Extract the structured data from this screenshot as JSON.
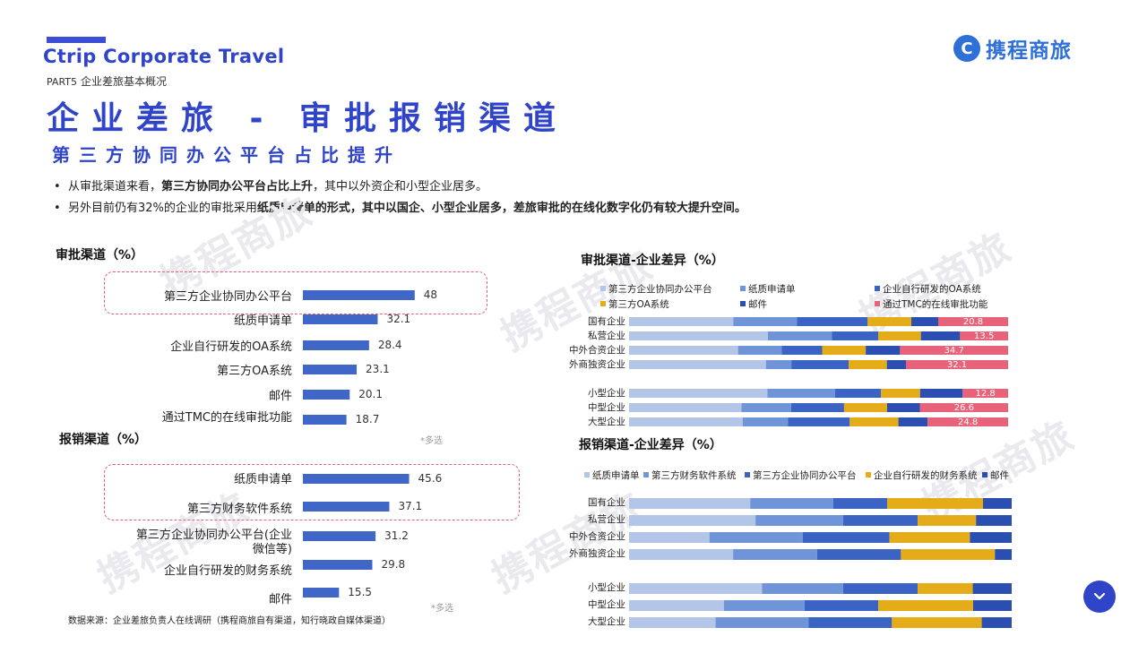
{
  "header": {
    "brand": "Ctrip Corporate Travel",
    "part_number": "PART5",
    "part_title": "企业差旅基本概况",
    "logo_text": "携程商旅",
    "title": "企业差旅 - 审批报销渠道",
    "subtitle": "第三方协同办公平台占比提升"
  },
  "bullets": [
    {
      "text_a": "从审批渠道来看，",
      "text_b": "第三方协同办公平台占比上升",
      "text_c": "，其中以外资企和小型企业居多。"
    },
    {
      "text_a": "另外目前仍有32%的企业的审批采用",
      "text_b": "纸质申请单的形式，其中以国企、小型企业居多，差旅审批的在线化数字化仍有较大提升空间。",
      "text_c": ""
    }
  ],
  "watermark": "携程商旅",
  "footer": {
    "note_approval": "*多选",
    "note_reimburse": "*多选",
    "source": "数据来源：企业差旅负责人在线调研（携程商旅自有渠道，知行晓政自媒体渠道）"
  },
  "colors": {
    "brand": "#2f44c8",
    "bar": "#4066c8",
    "s1": "#b4c6e7",
    "s2": "#6f94d8",
    "s3": "#3b63c4",
    "s4": "#e3ac18",
    "s5": "#2b4fb0",
    "s6": "#e8637a"
  },
  "chart_data": [
    {
      "id": "approval",
      "type": "bar",
      "title": "审批渠道（%）",
      "orientation": "horizontal",
      "categories": [
        "第三方企业协同办公平台",
        "纸质申请单",
        "企业自行研发的OA系统",
        "第三方OA系统",
        "邮件",
        "通过TMC的在线审批功能"
      ],
      "values": [
        48,
        32.1,
        28.4,
        23.1,
        20.1,
        18.7
      ],
      "value_labels": [
        "48",
        "32.1",
        "28.4",
        "23.1",
        "20.1",
        "18.7"
      ],
      "xlim": [
        0,
        60
      ]
    },
    {
      "id": "reimburse",
      "type": "bar",
      "title": "报销渠道（%）",
      "orientation": "horizontal",
      "categories": [
        "纸质申请单",
        "第三方财务软件系统",
        "第三方企业协同办公平台(企业微信等)",
        "企业自行研发的财务系统",
        "邮件"
      ],
      "values": [
        45.6,
        37.1,
        31.2,
        29.8,
        15.5
      ],
      "value_labels": [
        "45.6",
        "37.1",
        "31.2",
        "29.8",
        "15.5"
      ],
      "xlim": [
        0,
        60
      ]
    },
    {
      "id": "approval_diff",
      "type": "bar",
      "stacked": true,
      "orientation": "horizontal",
      "title": "审批渠道-企业差异（%）",
      "categories": [
        "国有企业",
        "私营企业",
        "中外合资企业",
        "外商独资企业",
        "小型企业",
        "中型企业",
        "大型企业"
      ],
      "series": [
        {
          "name": "第三方企业协同办公平台",
          "values": [
            31,
            39,
            35,
            43,
            39,
            34,
            35
          ]
        },
        {
          "name": "纸质申请单",
          "values": [
            19,
            18,
            14,
            8,
            19,
            15,
            14
          ]
        },
        {
          "name": "企业自行研发的OA系统",
          "values": [
            21,
            13,
            13,
            18,
            13,
            16,
            19
          ]
        },
        {
          "name": "第三方OA系统",
          "values": [
            13,
            12,
            14,
            12,
            11,
            13,
            15
          ]
        },
        {
          "name": "邮件",
          "values": [
            8,
            11,
            11,
            6,
            12,
            10,
            9
          ]
        },
        {
          "name": "通过TMC的在线审批功能",
          "values": [
            20.8,
            13.5,
            34.7,
            32.1,
            12.8,
            26.6,
            24.8
          ]
        }
      ],
      "labels": [
        {
          "category": "国有企业",
          "text": "20.8"
        },
        {
          "category": "私营企业",
          "text": "13.5"
        },
        {
          "category": "中外合资企业",
          "text": "34.7"
        },
        {
          "category": "外商独资企业",
          "text": "32.1"
        },
        {
          "category": "小型企业",
          "text": "12.8"
        },
        {
          "category": "中型企业",
          "text": "26.6"
        },
        {
          "category": "大型企业",
          "text": "24.8"
        }
      ],
      "legend": "top"
    },
    {
      "id": "reimburse_diff",
      "type": "bar",
      "stacked": true,
      "orientation": "horizontal",
      "title": "报销渠道-企业差异（%）",
      "categories": [
        "国有企业",
        "私营企业",
        "中外合资企业",
        "外商独资企业",
        "小型企业",
        "中型企业",
        "大型企业"
      ],
      "series": [
        {
          "name": "纸质申请单",
          "values": [
            38,
            39,
            25,
            31,
            41,
            27,
            26
          ]
        },
        {
          "name": "第三方财务软件系统",
          "values": [
            26,
            27,
            29,
            25,
            25,
            23,
            28
          ]
        },
        {
          "name": "第三方企业协同办公平台",
          "values": [
            17,
            23,
            27,
            25,
            23,
            21,
            25
          ]
        },
        {
          "name": "企业自行研发的财务系统",
          "values": [
            30,
            18,
            25,
            28,
            17,
            27,
            27
          ]
        },
        {
          "name": "邮件",
          "values": [
            9,
            11,
            13,
            5,
            12,
            11,
            9
          ]
        }
      ],
      "legend": "top"
    }
  ]
}
